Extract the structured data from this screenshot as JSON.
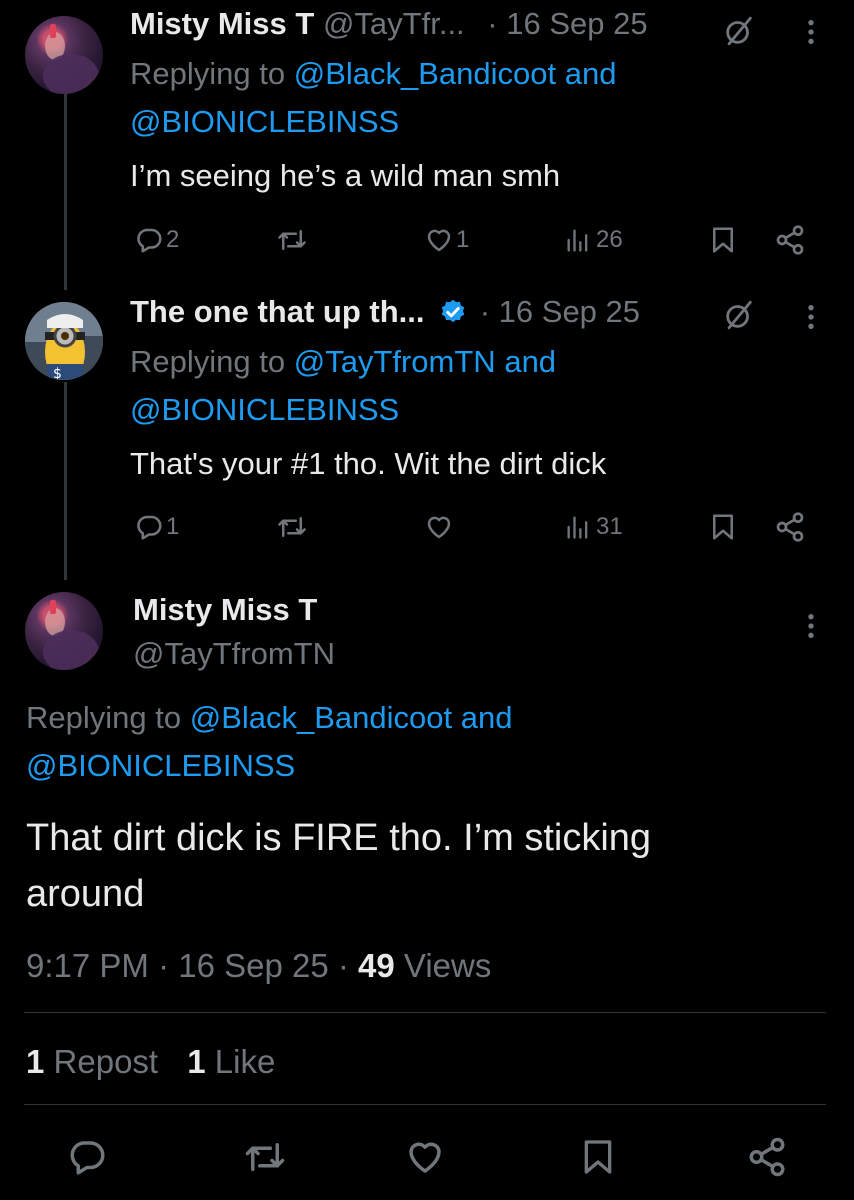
{
  "colors": {
    "background": "#000000",
    "text": "#e7e9ea",
    "secondary": "#71767b",
    "link": "#1d9bf0",
    "verified": "#1d9bf0",
    "divider": "#2f3336"
  },
  "tweets": [
    {
      "name": "Misty Miss T",
      "handle": "@TayTfr...",
      "date": "· 16 Sep 25",
      "replying_prefix": "Replying to",
      "reply_user1": "@Black_Bandicoot",
      "reply_and": "and",
      "reply_user2": "@BIONICLEBINSS",
      "text": "I’m seeing he’s a wild man smh",
      "replies": "2",
      "reposts": "",
      "likes": "1",
      "views": "26"
    },
    {
      "name": "The one that up th...",
      "verified": true,
      "date": "· 16 Sep 25",
      "replying_prefix": "Replying to",
      "reply_user1": "@TayTfromTN",
      "reply_and": "and",
      "reply_user2": "@BIONICLEBINSS",
      "text": "That's your #1 tho. Wit the dirt dick",
      "replies": "1",
      "reposts": "",
      "likes": "",
      "views": "31"
    }
  ],
  "main": {
    "name": "Misty Miss T",
    "handle": "@TayTfromTN",
    "replying_prefix": "Replying to",
    "reply_user1": "@Black_Bandicoot",
    "reply_and": "and",
    "reply_user2": "@BIONICLEBINSS",
    "text": "That dirt dick is FIRE tho. I’m sticking around",
    "time": "9:17 PM",
    "date": "· 16 Sep 25 ·",
    "views_count": "49",
    "views_label": "Views",
    "repost_count": "1",
    "repost_label": "Repost",
    "like_count": "1",
    "like_label": "Like"
  },
  "icons": [
    "reply-icon",
    "repost-icon",
    "like-icon",
    "views-icon",
    "bookmark-icon",
    "share-icon",
    "grok-icon",
    "more-icon",
    "verified-icon"
  ]
}
